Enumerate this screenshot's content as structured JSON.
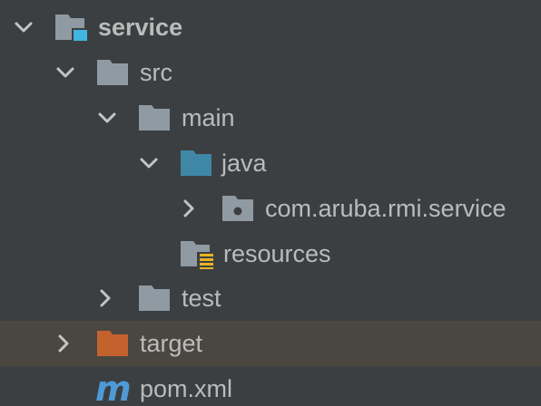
{
  "project_tree": {
    "nodes": [
      {
        "label": "service",
        "expanded": true,
        "bold": true,
        "icon": "module-folder-icon"
      },
      {
        "label": "src",
        "expanded": true,
        "icon": "folder-icon"
      },
      {
        "label": "main",
        "expanded": true,
        "icon": "folder-icon"
      },
      {
        "label": "java",
        "expanded": true,
        "icon": "source-root-folder-icon"
      },
      {
        "label": "com.aruba.rmi.service",
        "expanded": false,
        "icon": "package-icon"
      },
      {
        "label": "resources",
        "icon": "resources-root-folder-icon"
      },
      {
        "label": "test",
        "expanded": false,
        "icon": "folder-icon"
      },
      {
        "label": "target",
        "expanded": false,
        "selected": true,
        "icon": "excluded-folder-icon"
      },
      {
        "label": "pom.xml",
        "icon": "maven-file-icon"
      }
    ]
  },
  "colors": {
    "background": "#3c3f41",
    "selection": "#4a4741",
    "text": "#bbbbbb",
    "folder_grey": "#8f9aa3",
    "source_blue": "#3f87a6",
    "excluded_orange": "#c4622e",
    "module_marker": "#40b6e0",
    "resource_marker": "#e6b422",
    "maven_blue": "#4e9ad6"
  }
}
